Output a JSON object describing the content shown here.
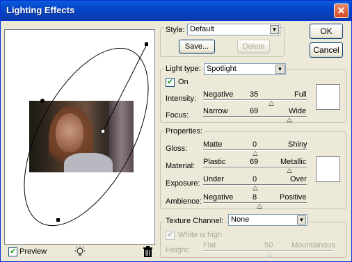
{
  "window": {
    "title": "Lighting Effects",
    "close_glyph": "✕"
  },
  "preview": {
    "label": "Preview",
    "checked": true
  },
  "style": {
    "label": "Style:",
    "value": "Default",
    "save_label": "Save...",
    "delete_label": "Delete"
  },
  "buttons": {
    "ok": "OK",
    "cancel": "Cancel"
  },
  "light_type": {
    "label": "Light type:",
    "value": "Spotlight",
    "on_label": "On",
    "on_checked": true,
    "intensity": {
      "label": "Intensity:",
      "min": "Negative",
      "max": "Full",
      "value": "35"
    },
    "focus": {
      "label": "Focus:",
      "min": "Narrow",
      "max": "Wide",
      "value": "69"
    }
  },
  "properties": {
    "label": "Properties:",
    "gloss": {
      "label": "Gloss:",
      "min": "Matte",
      "max": "Shiny",
      "value": "0"
    },
    "material": {
      "label": "Material:",
      "min": "Plastic",
      "max": "Metallic",
      "value": "69"
    },
    "exposure": {
      "label": "Exposure:",
      "min": "Under",
      "max": "Over",
      "value": "0"
    },
    "ambience": {
      "label": "Ambience:",
      "min": "Negative",
      "max": "Positive",
      "value": "8"
    }
  },
  "texture": {
    "label": "Texture Channel:",
    "value": "None",
    "white_is_high": "White is high",
    "height": {
      "label": "Height:",
      "min": "Flat",
      "max": "Mountainous",
      "value": "50"
    }
  },
  "icons": {
    "light_bulb": "light-bulb-icon",
    "trash": "trash-icon"
  }
}
